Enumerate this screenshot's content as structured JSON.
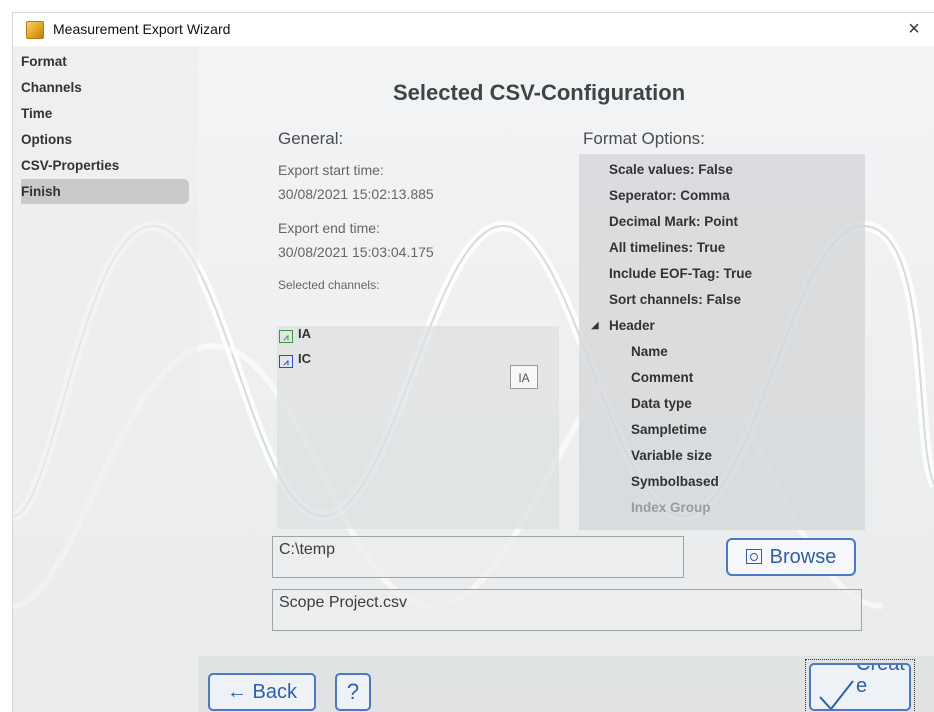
{
  "window": {
    "title": "Measurement Export Wizard",
    "close_glyph": "×"
  },
  "sidebar": {
    "items": [
      {
        "label": "Format",
        "active": false
      },
      {
        "label": "Channels",
        "active": false
      },
      {
        "label": "Time",
        "active": false
      },
      {
        "label": "Options",
        "active": false
      },
      {
        "label": "CSV-Properties",
        "active": false
      },
      {
        "label": "Finish",
        "active": true
      }
    ]
  },
  "main": {
    "title": "Selected CSV-Configuration",
    "general": {
      "heading": "General:",
      "start_label": "Export start time:",
      "start_value": "30/08/2021 15:02:13.885",
      "end_label": "Export end time:",
      "end_value": "30/08/2021 15:03:04.175",
      "channels_label": "Selected channels:",
      "channels": [
        {
          "name": "IA",
          "color": "#3a9a3a"
        },
        {
          "name": "IC",
          "color": "#2b4fc4"
        }
      ],
      "channel_tag": "IA"
    },
    "format": {
      "heading": "Format Options:",
      "options": [
        "Scale values: False",
        "Seperator: Comma",
        "Decimal Mark: Point",
        "All timelines: True",
        "Include EOF-Tag: True",
        "Sort channels: False"
      ],
      "header_group": {
        "label": "Header",
        "children": [
          "Name",
          "Comment",
          "Data type",
          "Sampletime",
          "Variable size",
          "Symbolbased",
          "Index Group"
        ]
      }
    },
    "path_value": "C:\\temp",
    "file_value": "Scope Project.csv",
    "browse_label": "Browse"
  },
  "footer": {
    "back_label": "← Back",
    "help_label": "?",
    "create_label": "Create"
  },
  "colors": {
    "accent": "#4a78c2",
    "text": "#333333"
  }
}
